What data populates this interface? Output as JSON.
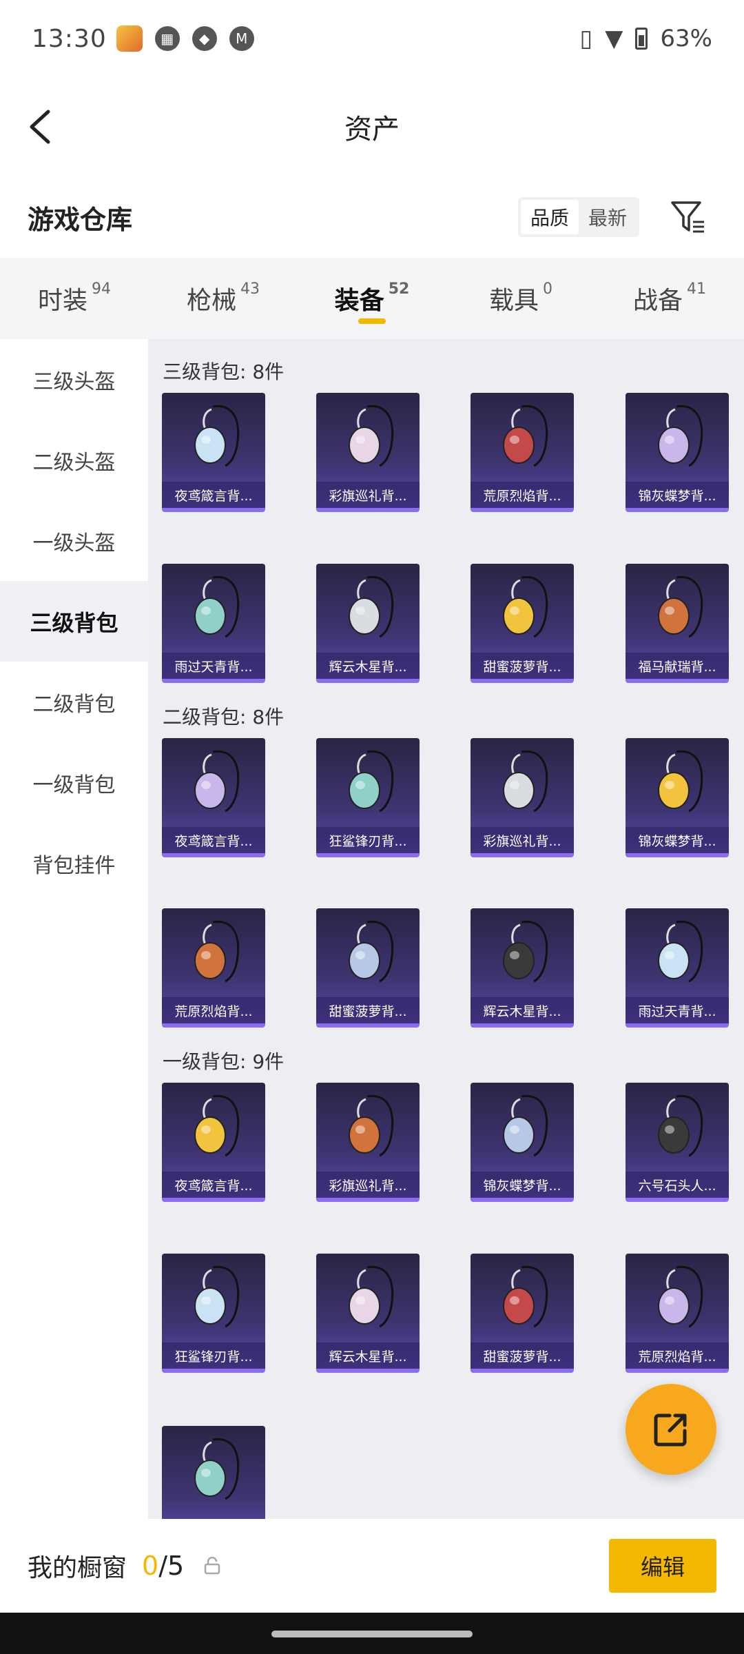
{
  "status": {
    "time": "13:30",
    "battery": "63%"
  },
  "header": {
    "title": "资产"
  },
  "subhead": {
    "title": "游戏仓库",
    "sort_quality": "品质",
    "sort_newest": "最新"
  },
  "tabs": [
    {
      "label": "时装",
      "count": "94"
    },
    {
      "label": "枪械",
      "count": "43"
    },
    {
      "label": "装备",
      "count": "52"
    },
    {
      "label": "载具",
      "count": "0"
    },
    {
      "label": "战备",
      "count": "41"
    }
  ],
  "sidebar": [
    "三级头盔",
    "二级头盔",
    "一级头盔",
    "三级背包",
    "二级背包",
    "一级背包",
    "背包挂件"
  ],
  "sections": [
    {
      "title": "三级背包: 8件",
      "items": [
        "夜鸢箴言背...",
        "彩旗巡礼背...",
        "荒原烈焰背...",
        "锦灰蝶梦背...",
        "雨过天青背...",
        "辉云木星背...",
        "甜蜜菠萝背...",
        "福马献瑞背..."
      ]
    },
    {
      "title": "二级背包: 8件",
      "items": [
        "夜鸢箴言背...",
        "狂鲨锋刃背...",
        "彩旗巡礼背...",
        "锦灰蝶梦背...",
        "荒原烈焰背...",
        "甜蜜菠萝背...",
        "辉云木星背...",
        "雨过天青背..."
      ]
    },
    {
      "title": "一级背包: 9件",
      "items": [
        "夜鸢箴言背...",
        "彩旗巡礼背...",
        "锦灰蝶梦背...",
        "六号石头人...",
        "狂鲨锋刃背...",
        "辉云木星背...",
        "甜蜜菠萝背...",
        "荒原烈焰背...",
        ""
      ]
    }
  ],
  "bottom": {
    "label": "我的橱窗",
    "used": "0",
    "total": "/5",
    "edit": "编辑"
  },
  "colors": {
    "accent": "#f5b800",
    "fab": "#f7a81c",
    "card_top": "#2a2545",
    "card_bottom": "#5a48a8"
  }
}
